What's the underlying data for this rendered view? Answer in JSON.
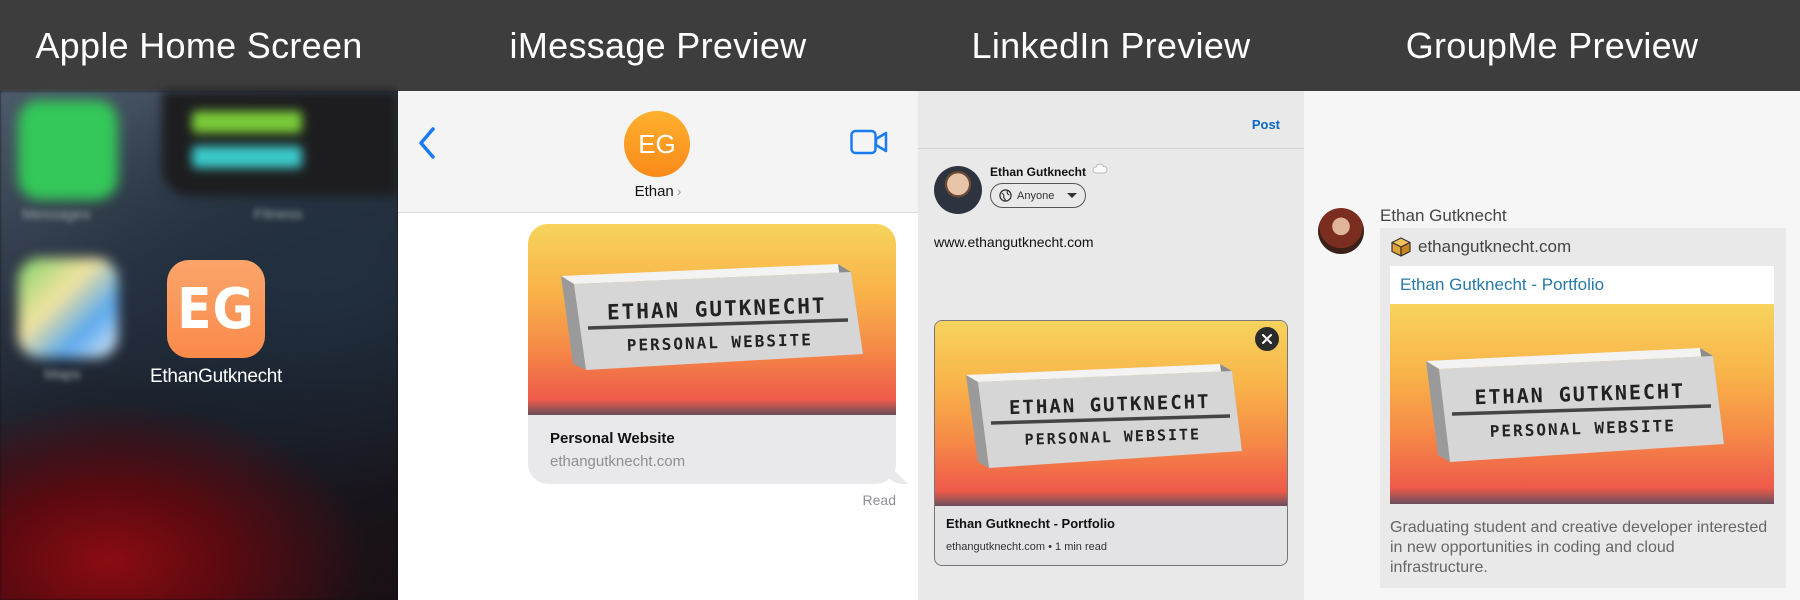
{
  "panels": {
    "home": {
      "title": "Apple Home Screen",
      "app_icon_text": "EG",
      "app_label": "EthanGutknecht",
      "blurred_labels": [
        "Messages",
        "Fitness",
        "Maps"
      ]
    },
    "imessage": {
      "title": "iMessage Preview",
      "contact_initials": "EG",
      "contact_name": "Ethan",
      "contact_chevron": "›",
      "preview_title": "Personal Website",
      "preview_url": "ethangutknecht.com",
      "status": "Read"
    },
    "linkedin": {
      "title": "LinkedIn Preview",
      "post_button": "Post",
      "author": "Ethan Gutknecht",
      "visibility": "Anyone",
      "post_text": "www.ethangutknecht.com",
      "card_title": "Ethan Gutknecht - Portfolio",
      "card_meta": "ethangutknecht.com • 1 min read"
    },
    "groupme": {
      "title": "GroupMe Preview",
      "sender": "Ethan Gutknecht",
      "site": "ethangutknecht.com",
      "link_title": "Ethan Gutknecht - Portfolio",
      "description": "Graduating student and creative developer interested in new opportunities in coding and cloud infrastructure."
    }
  },
  "preview_image": {
    "line1": "ETHAN GUTKNECHT",
    "line2": "PERSONAL WEBSITE"
  },
  "colors": {
    "header_bg": "#3d3d3d",
    "ios_blue": "#1a7cf5",
    "eg_orange": "#f98a4a",
    "linkedin_blue": "#0a66c2",
    "groupme_link": "#2779a7"
  }
}
